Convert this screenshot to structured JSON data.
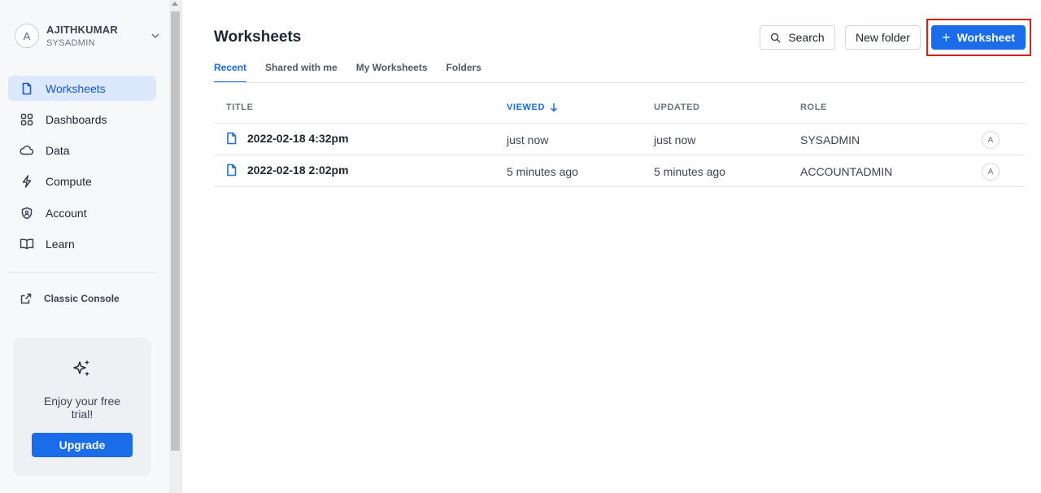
{
  "user": {
    "initial": "A",
    "name": "AJITHKUMAR",
    "role": "SYSADMIN"
  },
  "sidebar": {
    "items": [
      {
        "label": "Worksheets",
        "icon": "file-icon",
        "active": true
      },
      {
        "label": "Dashboards",
        "icon": "grid-icon"
      },
      {
        "label": "Data",
        "icon": "cloud-icon"
      },
      {
        "label": "Compute",
        "icon": "bolt-icon"
      },
      {
        "label": "Account",
        "icon": "shield-icon"
      },
      {
        "label": "Learn",
        "icon": "book-icon"
      }
    ],
    "classic_console": "Classic Console",
    "trial": {
      "text": "Enjoy your free trial!",
      "button": "Upgrade"
    }
  },
  "header": {
    "title": "Worksheets",
    "search_label": "Search",
    "new_folder_label": "New folder",
    "new_worksheet_label": "Worksheet"
  },
  "tabs": [
    {
      "label": "Recent",
      "active": true
    },
    {
      "label": "Shared with me"
    },
    {
      "label": "My Worksheets"
    },
    {
      "label": "Folders"
    }
  ],
  "table": {
    "columns": [
      "TITLE",
      "VIEWED",
      "UPDATED",
      "ROLE"
    ],
    "rows": [
      {
        "title": "2022-02-18 4:32pm",
        "viewed": "just now",
        "updated": "just now",
        "role": "SYSADMIN",
        "owner": "A"
      },
      {
        "title": "2022-02-18 2:02pm",
        "viewed": "5 minutes ago",
        "updated": "5 minutes ago",
        "role": "ACCOUNTADMIN",
        "owner": "A"
      }
    ]
  },
  "colors": {
    "accent": "#1a6ce8",
    "active_nav_bg": "#dce8fb",
    "highlight": "#d61f1f"
  }
}
